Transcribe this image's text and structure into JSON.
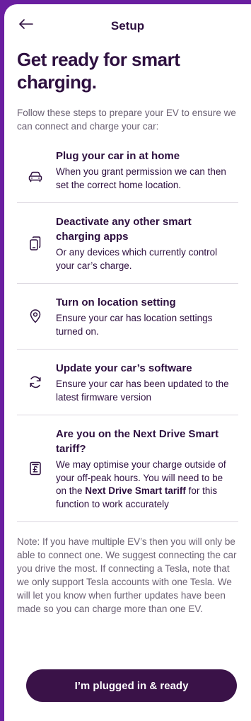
{
  "header": {
    "title": "Setup",
    "back_icon": "arrow-left-icon"
  },
  "page": {
    "title": "Get ready for smart charging.",
    "intro": "Follow these steps to prepare your EV to ensure we can connect and charge your car:"
  },
  "steps": [
    {
      "icon": "car-icon",
      "title": "Plug your car in at home",
      "body": "When you grant permission we can then set the correct home location."
    },
    {
      "icon": "devices-icon",
      "title": "Deactivate any other smart charging apps",
      "body": "Or any devices which currently control your car’s charge."
    },
    {
      "icon": "location-pin-icon",
      "title": "Turn on location setting",
      "body": "Ensure your car has location settings turned on."
    },
    {
      "icon": "refresh-icon",
      "title": "Update your car’s software",
      "body": "Ensure your car has been updated to the latest firmware version"
    },
    {
      "icon": "tariff-pound-icon",
      "title": "Are you on the Next Drive Smart tariff?",
      "body_before": "We may optimise your charge outside of your off-peak hours. You will need to be on the ",
      "body_bold": "Next Drive Smart tariff",
      "body_after": " for this function to work accurately"
    }
  ],
  "note": "Note: If you have multiple EV’s then you will only be able to connect one. We suggest connecting the car you drive the most. If connecting a Tesla, note that we only support Tesla accounts with one Tesla. We will let you know when further updates have been made so you can charge more than one EV.",
  "cta": {
    "label": "I’m plugged in & ready"
  },
  "colors": {
    "frame_border": "#6a1ea0",
    "primary_text": "#2d0f3f",
    "secondary_text": "#6b6173",
    "button_bg": "#3a1248",
    "divider": "#dcd7e0"
  }
}
